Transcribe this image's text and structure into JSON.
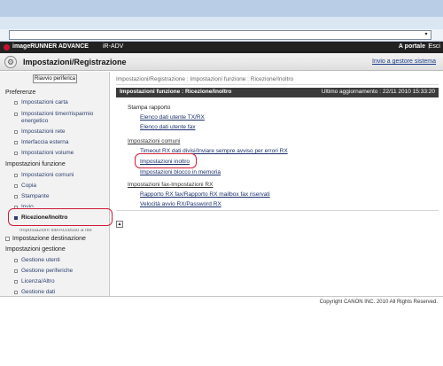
{
  "browser": {
    "address_value": "",
    "dropdown_glyph": "▾"
  },
  "app_bar": {
    "product_name": "imageRUNNER ADVANCE",
    "device_name": "iR-ADV",
    "portal_link": "A portale",
    "separator": "|",
    "exit_link": "Esci"
  },
  "title_bar": {
    "title": "Impostazioni/Registrazione",
    "send_to_manager": "Invio a gestore sistema"
  },
  "sidebar": {
    "restart_button": "Riavvio periferica",
    "preferences_heading": "Preferenze",
    "preferences_items": [
      "Impostazioni carta",
      "Impostazioni timer/risparmio energetico",
      "Impostazioni rete",
      "Interfaccia esterna",
      "Impostazioni volume"
    ],
    "function_settings_heading": "Impostazioni funzione",
    "function_items": [
      "Impostazioni comuni",
      "Copia",
      "Stampante",
      "Invio",
      "Ricezione/Inoltro"
    ],
    "cut_off_item": "Impostazioni file/Accesso a file",
    "destination_heading": "Impostazione destinazione",
    "management_heading": "Impostazioni gestione",
    "management_items": [
      "Gestione utenti",
      "Gestione periferiche",
      "Licenza/Altro",
      "Gestione dati"
    ]
  },
  "main": {
    "breadcrumb": "Impostazioni/Registrazione : Impostazioni funzione : Ricezione/Inoltro",
    "panel_title": "Impostazioni funzione : Ricezione/Inoltro",
    "last_update": "Ultimo aggiornamento : 22/11 2010 15:33:20",
    "groups": [
      {
        "heading": "Stampa rapporto",
        "links": [
          "Elenco dati utente TX/RX",
          "Elenco dati utente fax"
        ]
      },
      {
        "heading": "Impostazioni comuni",
        "links": [
          "Timeout RX dati divisi/Inviare sempre avviso per errori RX",
          "Impostazioni inoltro",
          "Impostazioni blocco in memoria"
        ]
      },
      {
        "heading": "Impostazioni fax-Impostazioni RX",
        "links": [
          "Rapporto RX fax/Rapporto RX mailbox fax riservati",
          "Velocità avvio RX/Password RX"
        ]
      }
    ],
    "top_button_glyph": "▲"
  },
  "footer": {
    "copyright": "Copyright CANON INC. 2010 All Rights Reserved."
  },
  "colors": {
    "highlight_ring": "#d11c3a",
    "app_bar": "#222222",
    "link": "#1a2f6a"
  }
}
